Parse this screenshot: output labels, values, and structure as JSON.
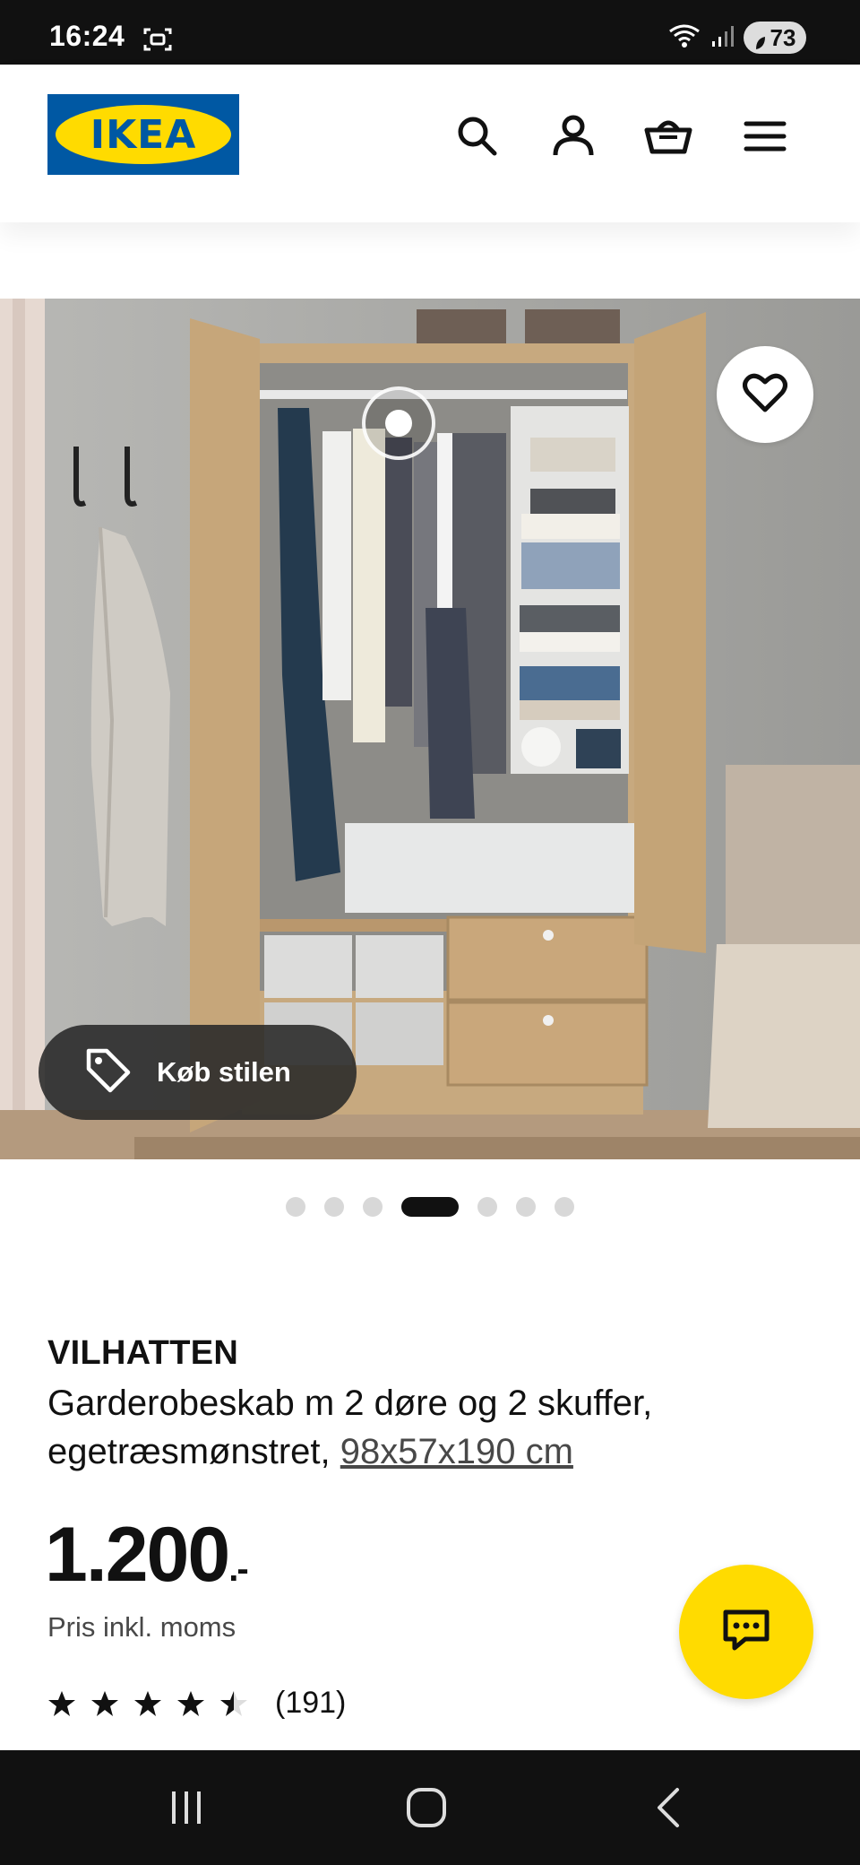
{
  "status_bar": {
    "time": "16:24",
    "battery": "73"
  },
  "header": {
    "logo_text": "IKEA",
    "icons": [
      "search-icon",
      "account-icon",
      "basket-icon",
      "menu-icon"
    ]
  },
  "gallery": {
    "buy_style_label": "Køb stilen",
    "slide_count": 7,
    "active_slide": 4
  },
  "product": {
    "name": "VILHATTEN",
    "description": "Garderobeskab m 2 døre og 2 skuffer, egetræsmønstret,",
    "dimensions": "98x57x190 cm",
    "price": "1.200",
    "price_suffix": ".-",
    "price_note": "Pris inkl. moms",
    "rating": 4.5,
    "rating_max": 5,
    "review_count": "(191)"
  },
  "colors": {
    "ikea_blue": "#0058a3",
    "ikea_yellow": "#ffdb00"
  }
}
